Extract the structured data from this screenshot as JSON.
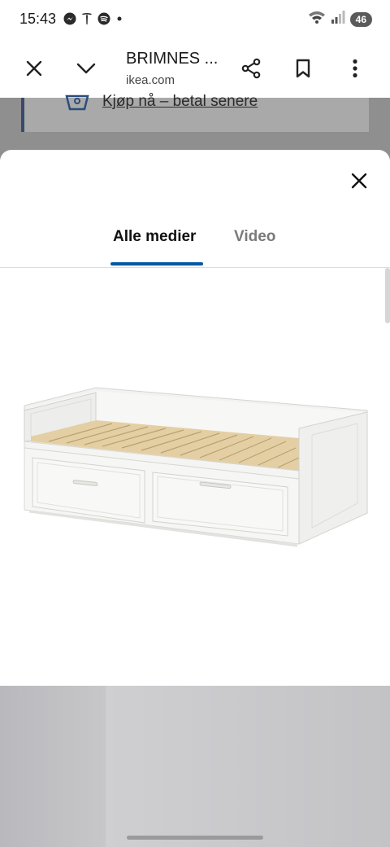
{
  "status_bar": {
    "time": "15:43",
    "battery": "46",
    "notification_icons": [
      "messenger-icon",
      "tesla-icon",
      "spotify-icon",
      "dot-icon"
    ],
    "system_icons": [
      "wifi-icon",
      "signal-icon",
      "battery-icon"
    ]
  },
  "browser": {
    "title": "BRIMNES ...",
    "url": "ikea.com",
    "left_icons": [
      "close-icon",
      "chevron-down-icon"
    ],
    "right_icons": [
      "share-icon",
      "bookmark-icon",
      "more-vert-icon"
    ]
  },
  "page_behind": {
    "link_text": "Kjøp nå – betal senere"
  },
  "sheet": {
    "tabs": [
      {
        "label": "Alle medier",
        "active": true
      },
      {
        "label": "Video",
        "active": false
      }
    ],
    "accent_color": "#0058a3",
    "media": [
      {
        "type": "product-image",
        "subject": "white daybed with drawers"
      },
      {
        "type": "room-photo",
        "subject": "grey wall corner"
      }
    ]
  }
}
